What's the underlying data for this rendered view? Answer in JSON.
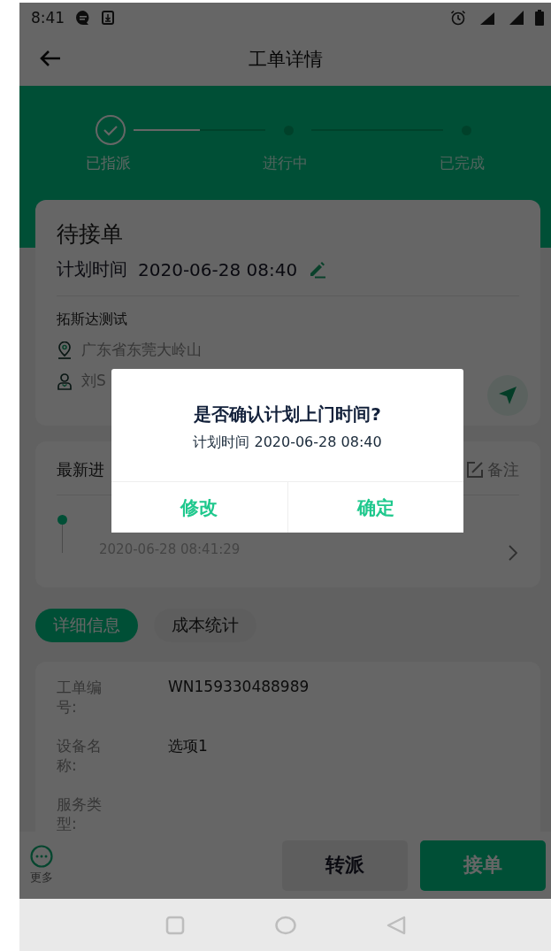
{
  "status_bar": {
    "time": "8:41"
  },
  "header": {
    "title": "工单详情"
  },
  "stepper": {
    "steps": [
      {
        "label": "已指派",
        "done": true
      },
      {
        "label": "进行中",
        "done": false
      },
      {
        "label": "已完成",
        "done": false
      }
    ],
    "connectors": [
      {
        "level": 0.5
      }
    ]
  },
  "order_card": {
    "status": "待接单",
    "plan_label": "计划时间",
    "plan_time": "2020-06-28 08:40",
    "customer": "拓斯达测试",
    "address": "广东省东莞大岭山",
    "contact": "刘S"
  },
  "progress_card": {
    "title": "最新进",
    "note_button": "备注",
    "entries": [
      {
        "time": "2020-06-28 08:41:29"
      }
    ]
  },
  "tabs": [
    {
      "label": "详细信息",
      "selected": true
    },
    {
      "label": "成本统计",
      "selected": false
    }
  ],
  "details": [
    {
      "label": "工单编号:",
      "value": "WN159330488989"
    },
    {
      "label": "设备名称:",
      "value": "选项1"
    },
    {
      "label": "服务类型:"
    }
  ],
  "bottom_bar": {
    "more": "更多",
    "buttons": [
      {
        "label": "转派",
        "kind": "secondary"
      },
      {
        "label": "接单",
        "kind": "primary"
      }
    ]
  },
  "dialog": {
    "title": "是否确认计划上门时间?",
    "message": "计划时间 2020-06-28 08:40",
    "buttons": [
      "修改",
      "确定"
    ]
  }
}
